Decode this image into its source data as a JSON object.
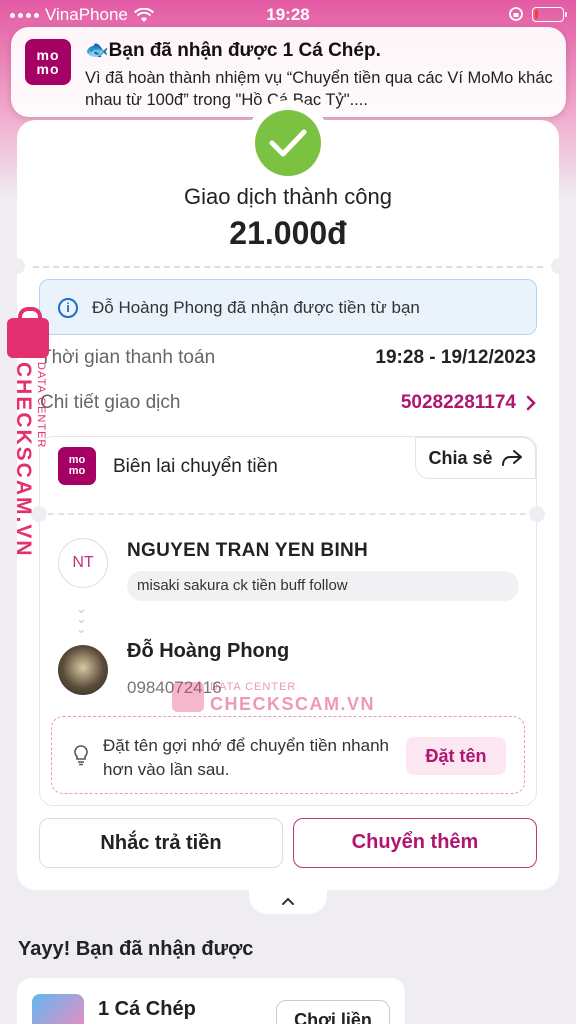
{
  "status_bar": {
    "carrier": "VinaPhone",
    "time": "19:28"
  },
  "notification": {
    "app_logo": "mo mo",
    "title": "🐟Bạn đã nhận được 1 Cá Chép.",
    "body": "Vì đã hoàn thành nhiệm vụ “Chuyển tiền qua các Ví MoMo khác nhau từ 100đ” trong \"Hồ Cá Bạc Tỷ\"...."
  },
  "transaction": {
    "status_title": "Giao dịch thành công",
    "amount": "21.000đ",
    "info_message": "Đỗ Hoàng Phong đã nhận được tiền từ bạn",
    "time_label": "Thời gian thanh toán",
    "time_value": "19:28 - 19/12/2023",
    "detail_label": "Chi tiết giao dịch",
    "detail_value": "50282281174"
  },
  "receipt": {
    "logo": "mo mo",
    "title": "Biên lai chuyển tiền",
    "share_label": "Chia sẻ",
    "sender": {
      "initials": "NT",
      "name": "NGUYEN TRAN YEN BINH",
      "message": "misaki sakura ck tiền buff follow"
    },
    "receiver": {
      "name": "Đỗ Hoàng Phong",
      "phone": "0984072416"
    },
    "nickname_hint": "Đặt tên gợi nhớ để chuyển tiền nhanh hơn vào lần sau.",
    "nickname_button": "Đặt tên"
  },
  "actions": {
    "remind_label": "Nhắc trả tiền",
    "transfer_more_label": "Chuyển thêm"
  },
  "rewards": {
    "heading": "Yayy! Bạn đã nhận được",
    "item_title": "1 Cá Chép",
    "play_button": "Chơi liền"
  },
  "watermark": {
    "brand": "CHECKSCAM.VN",
    "sub": "DATA CENTER"
  },
  "colors": {
    "brand": "#a50064",
    "accent": "#b0156f",
    "success": "#7cc242",
    "watermark": "#e3306e"
  },
  "icons": [
    "wifi-icon",
    "check-icon",
    "info-icon",
    "share-icon",
    "lightbulb-icon",
    "chevron-right-icon",
    "chevron-up-icon",
    "lock-icon"
  ]
}
